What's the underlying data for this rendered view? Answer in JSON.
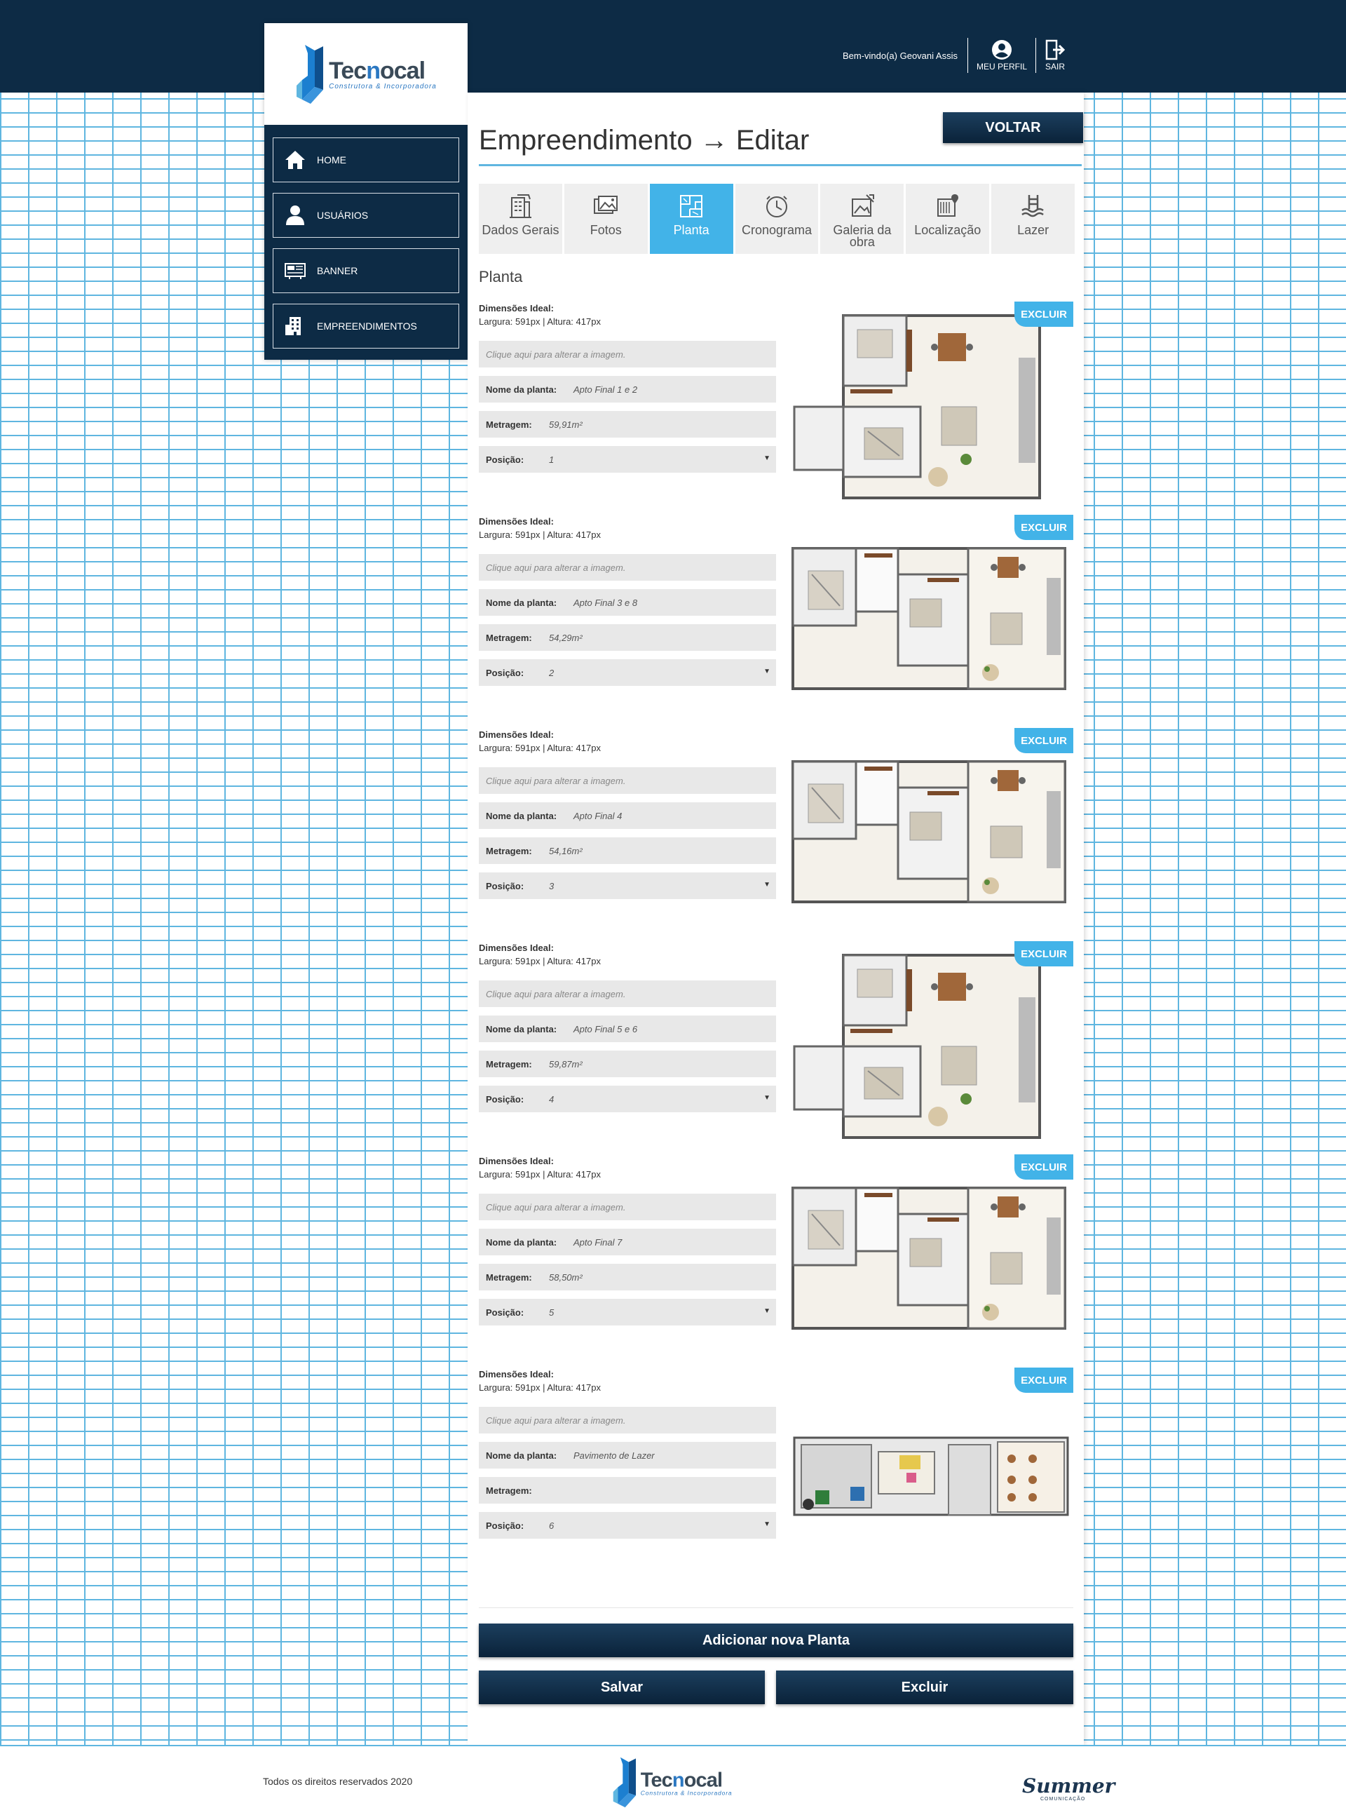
{
  "header": {
    "welcome": "Bem-vindo(a) Geovani Assis",
    "profile_label": "MEU PERFIL",
    "logout_label": "SAIR"
  },
  "brand": {
    "name_prefix": "Tec",
    "name_highlight": "n",
    "name_suffix": "ocal",
    "tagline": "Construtora & Incorporadora",
    "accent_color": "#2b78c2",
    "nav_color": "#0d2b45"
  },
  "sidebar": {
    "items": [
      {
        "label": "HOME",
        "icon": "home-icon"
      },
      {
        "label": "USUÁRIOS",
        "icon": "user-icon"
      },
      {
        "label": "BANNER",
        "icon": "banner-icon"
      },
      {
        "label": "EMPREENDIMENTOS",
        "icon": "building-icon"
      }
    ]
  },
  "main": {
    "title": "Empreendimento → Editar",
    "back_label": "VOLTAR",
    "tabs": [
      {
        "label": "Dados Gerais",
        "icon": "building-icon",
        "active": false
      },
      {
        "label": "Fotos",
        "icon": "photos-icon",
        "active": false
      },
      {
        "label": "Planta",
        "icon": "blueprint-icon",
        "active": true
      },
      {
        "label": "Cronograma",
        "icon": "clock-icon",
        "active": false
      },
      {
        "label": "Galeria da obra",
        "icon": "gallery-icon",
        "active": false
      },
      {
        "label": "Localização",
        "icon": "location-icon",
        "active": false
      },
      {
        "label": "Lazer",
        "icon": "pool-icon",
        "active": false
      }
    ],
    "section_title": "Planta",
    "labels": {
      "dims_title": "Dimensões Ideal:",
      "dims_value": "Largura: 591px | Altura: 417px",
      "image_placeholder": "Clique aqui para alterar a imagem.",
      "name": "Nome da planta:",
      "area": "Metragem:",
      "position": "Posição:",
      "delete_badge": "EXCLUIR"
    },
    "plants": [
      {
        "name": "Apto Final 1 e 2",
        "area": "59,91m²",
        "position": "1"
      },
      {
        "name": "Apto Final 3 e 8",
        "area": "54,29m²",
        "position": "2"
      },
      {
        "name": "Apto Final 4",
        "area": "54,16m²",
        "position": "3"
      },
      {
        "name": "Apto Final 5 e 6",
        "area": "59,87m²",
        "position": "4"
      },
      {
        "name": "Apto Final 7",
        "area": "58,50m²",
        "position": "5"
      },
      {
        "name": "Pavimento de Lazer",
        "area": "",
        "position": "6"
      }
    ],
    "add_label": "Adicionar nova Planta",
    "save_label": "Salvar",
    "delete_label": "Excluir"
  },
  "footer": {
    "copyright": "Todos os direitos reservados 2020",
    "partner": "Summer",
    "partner_sub": "COMUNICAÇÃO"
  }
}
